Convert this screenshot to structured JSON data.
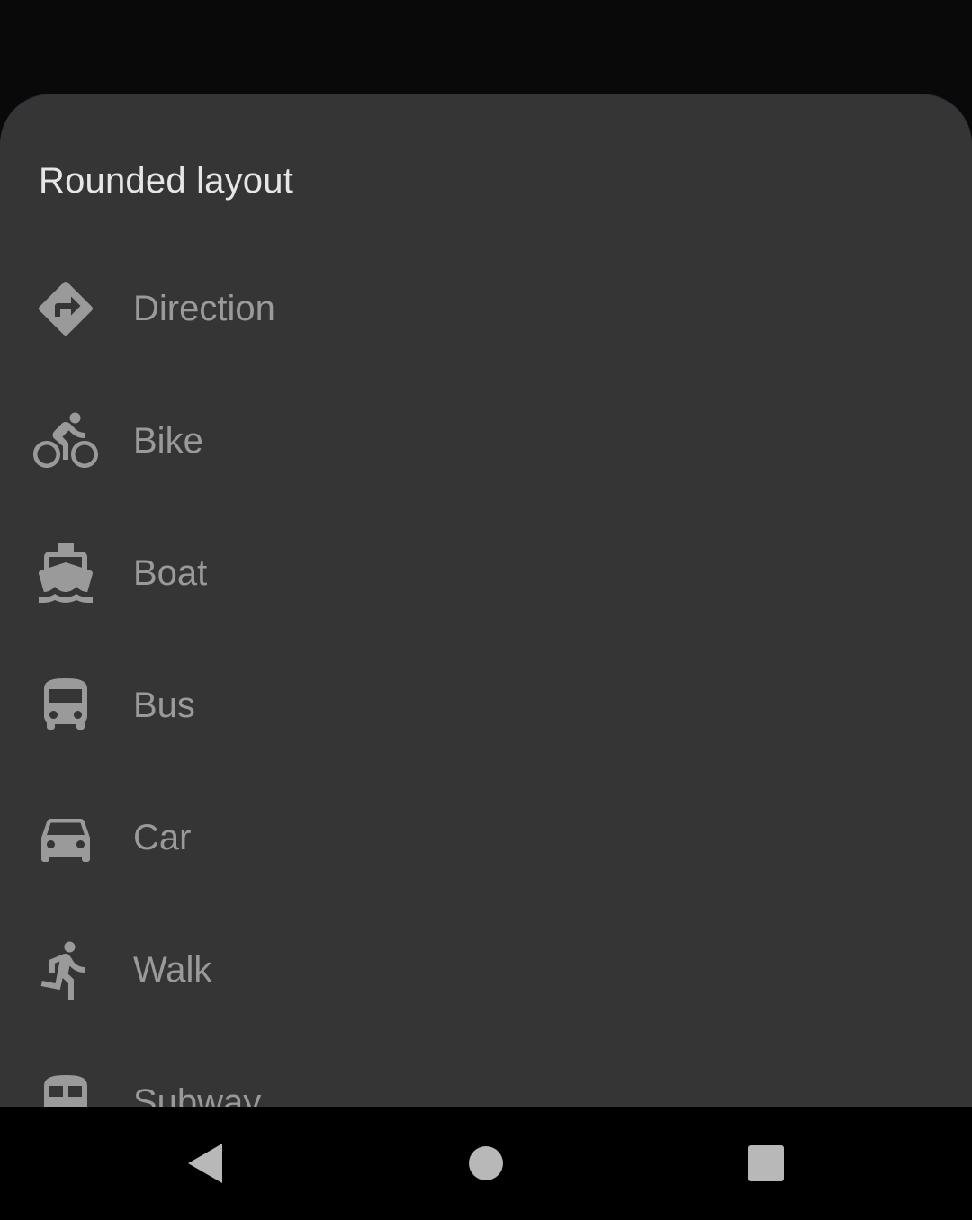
{
  "sheet": {
    "title": "Rounded layout",
    "items": [
      {
        "label": "Direction",
        "icon": "direction-icon"
      },
      {
        "label": "Bike",
        "icon": "bike-icon"
      },
      {
        "label": "Boat",
        "icon": "boat-icon"
      },
      {
        "label": "Bus",
        "icon": "bus-icon"
      },
      {
        "label": "Car",
        "icon": "car-icon"
      },
      {
        "label": "Walk",
        "icon": "walk-icon"
      },
      {
        "label": "Subway",
        "icon": "subway-icon"
      }
    ]
  },
  "navbar": {
    "back": "back-icon",
    "home": "home-icon",
    "recents": "recents-icon"
  },
  "colors": {
    "sheet_background": "#353535",
    "scrim": "#090909",
    "item_text": "#9a9a9a",
    "title_text": "#e6e6e6",
    "navbar": "#000000"
  }
}
